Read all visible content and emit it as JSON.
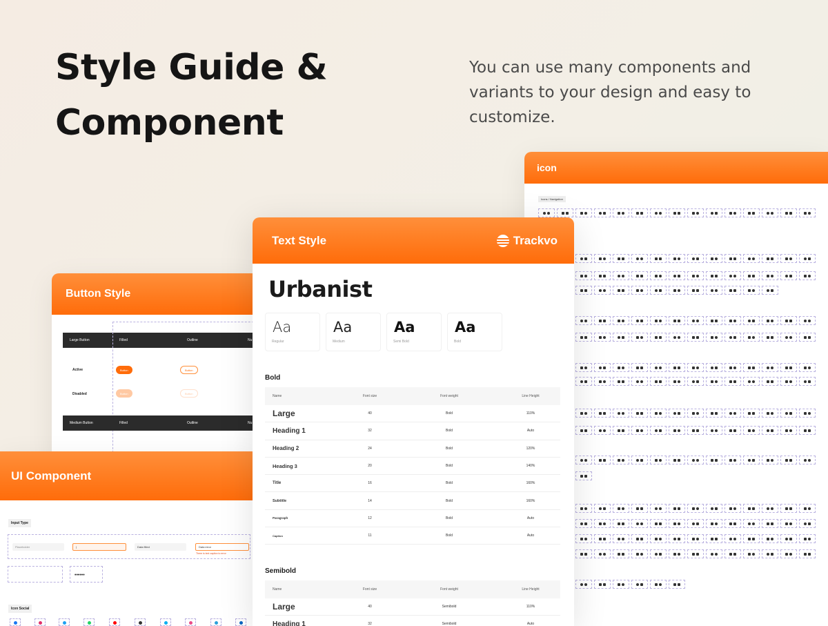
{
  "hero": {
    "title_line1": "Style Guide &",
    "title_line2": "Component",
    "description": "You can use many components and variants to your design and easy to customize."
  },
  "icon_card": {
    "title": "icon",
    "tag": "Icons / Navigation"
  },
  "button_card": {
    "title": "Button Style",
    "large_bar": {
      "label": "Large Button",
      "col1": "Filled",
      "col2": "Outline",
      "col3": "Nu"
    },
    "medium_bar": {
      "label": "Medium Button",
      "col1": "Filled",
      "col2": "Outline",
      "col3": "Nu"
    },
    "row_active": "Active",
    "row_disabled": "Disabled",
    "button_label": "Button"
  },
  "text_card": {
    "title": "Text Style",
    "brand": "Trackvo",
    "font_name": "Urbanist",
    "weights": [
      {
        "sample": "Aa",
        "label": "Regular"
      },
      {
        "sample": "Aa",
        "label": "Medium"
      },
      {
        "sample": "Aa",
        "label": "Semi Bold"
      },
      {
        "sample": "Aa",
        "label": "Bold"
      }
    ],
    "columns": [
      "Name",
      "Font size",
      "Font weight",
      "Line Height"
    ],
    "bold_title": "Bold",
    "bold_rows": [
      [
        "Large",
        "40",
        "Bold",
        "110%"
      ],
      [
        "Heading 1",
        "32",
        "Bold",
        "Auto"
      ],
      [
        "Heading 2",
        "24",
        "Bold",
        "120%"
      ],
      [
        "Heading 3",
        "20",
        "Bold",
        "140%"
      ],
      [
        "Title",
        "16",
        "Bold",
        "160%"
      ],
      [
        "Subtitle",
        "14",
        "Bold",
        "160%"
      ],
      [
        "Paragraph",
        "12",
        "Bold",
        "Auto"
      ],
      [
        "Caption",
        "11",
        "Bold",
        "Auto"
      ]
    ],
    "semibold_title": "Semibold",
    "semibold_rows": [
      [
        "Large",
        "40",
        "Semibold",
        "110%"
      ],
      [
        "Heading 1",
        "32",
        "Semibold",
        "Auto"
      ]
    ]
  },
  "ui_card": {
    "title": "UI Component",
    "input_tag": "Input Type",
    "social_tag": "Icon Social",
    "inputs": [
      {
        "label": "",
        "value": "Placeholder"
      },
      {
        "label": "Label",
        "value": "|"
      },
      {
        "label": "Label",
        "value": "Data filled"
      },
      {
        "label": "Label",
        "value": "Data error"
      }
    ],
    "error_text": "There is text caption to error",
    "password": "••••••"
  },
  "colors": {
    "accent": "#ff7a1c",
    "dark": "#2b2b2b"
  }
}
